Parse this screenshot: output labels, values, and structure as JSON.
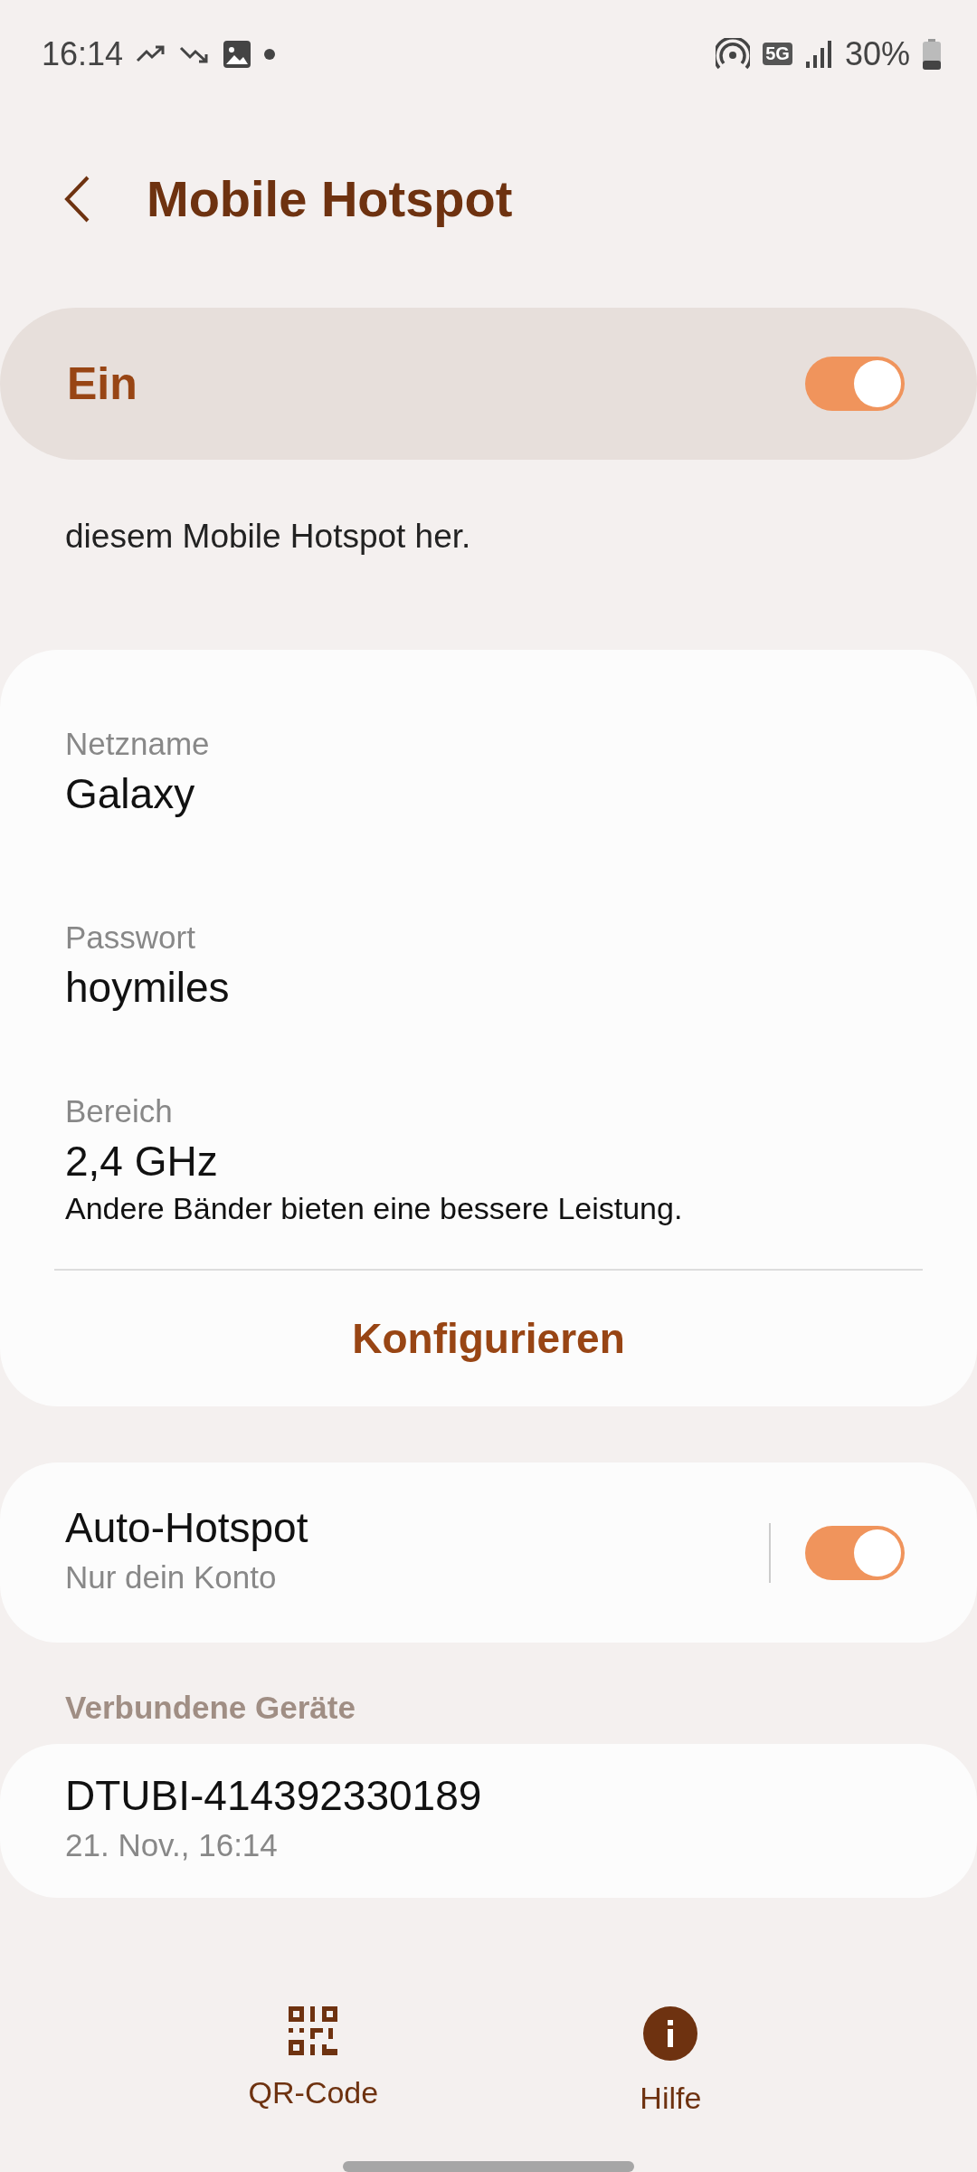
{
  "status_bar": {
    "time": "16:14",
    "network": "5G",
    "battery": "30%"
  },
  "header": {
    "title": "Mobile Hotspot"
  },
  "master_switch": {
    "label": "Ein",
    "on": true
  },
  "description": "diesem Mobile Hotspot her.",
  "settings": [
    {
      "label": "Netzname",
      "value": "Galaxy"
    },
    {
      "label": "Passwort",
      "value": "hoymiles"
    },
    {
      "label": "Bereich",
      "value": "2,4 GHz",
      "note": "Andere Bänder bieten eine bessere Leistung."
    }
  ],
  "configure_button": "Konfigurieren",
  "auto_hotspot": {
    "title": "Auto-Hotspot",
    "subtitle": "Nur dein Konto",
    "on": true
  },
  "devices_header": "Verbundene Geräte",
  "devices": [
    {
      "name": "DTUBI-414392330189",
      "time": "21. Nov., 16:14"
    }
  ],
  "bottom_nav": [
    {
      "kind": "qr",
      "label": "QR-Code"
    },
    {
      "kind": "info",
      "label": "Hilfe"
    }
  ]
}
